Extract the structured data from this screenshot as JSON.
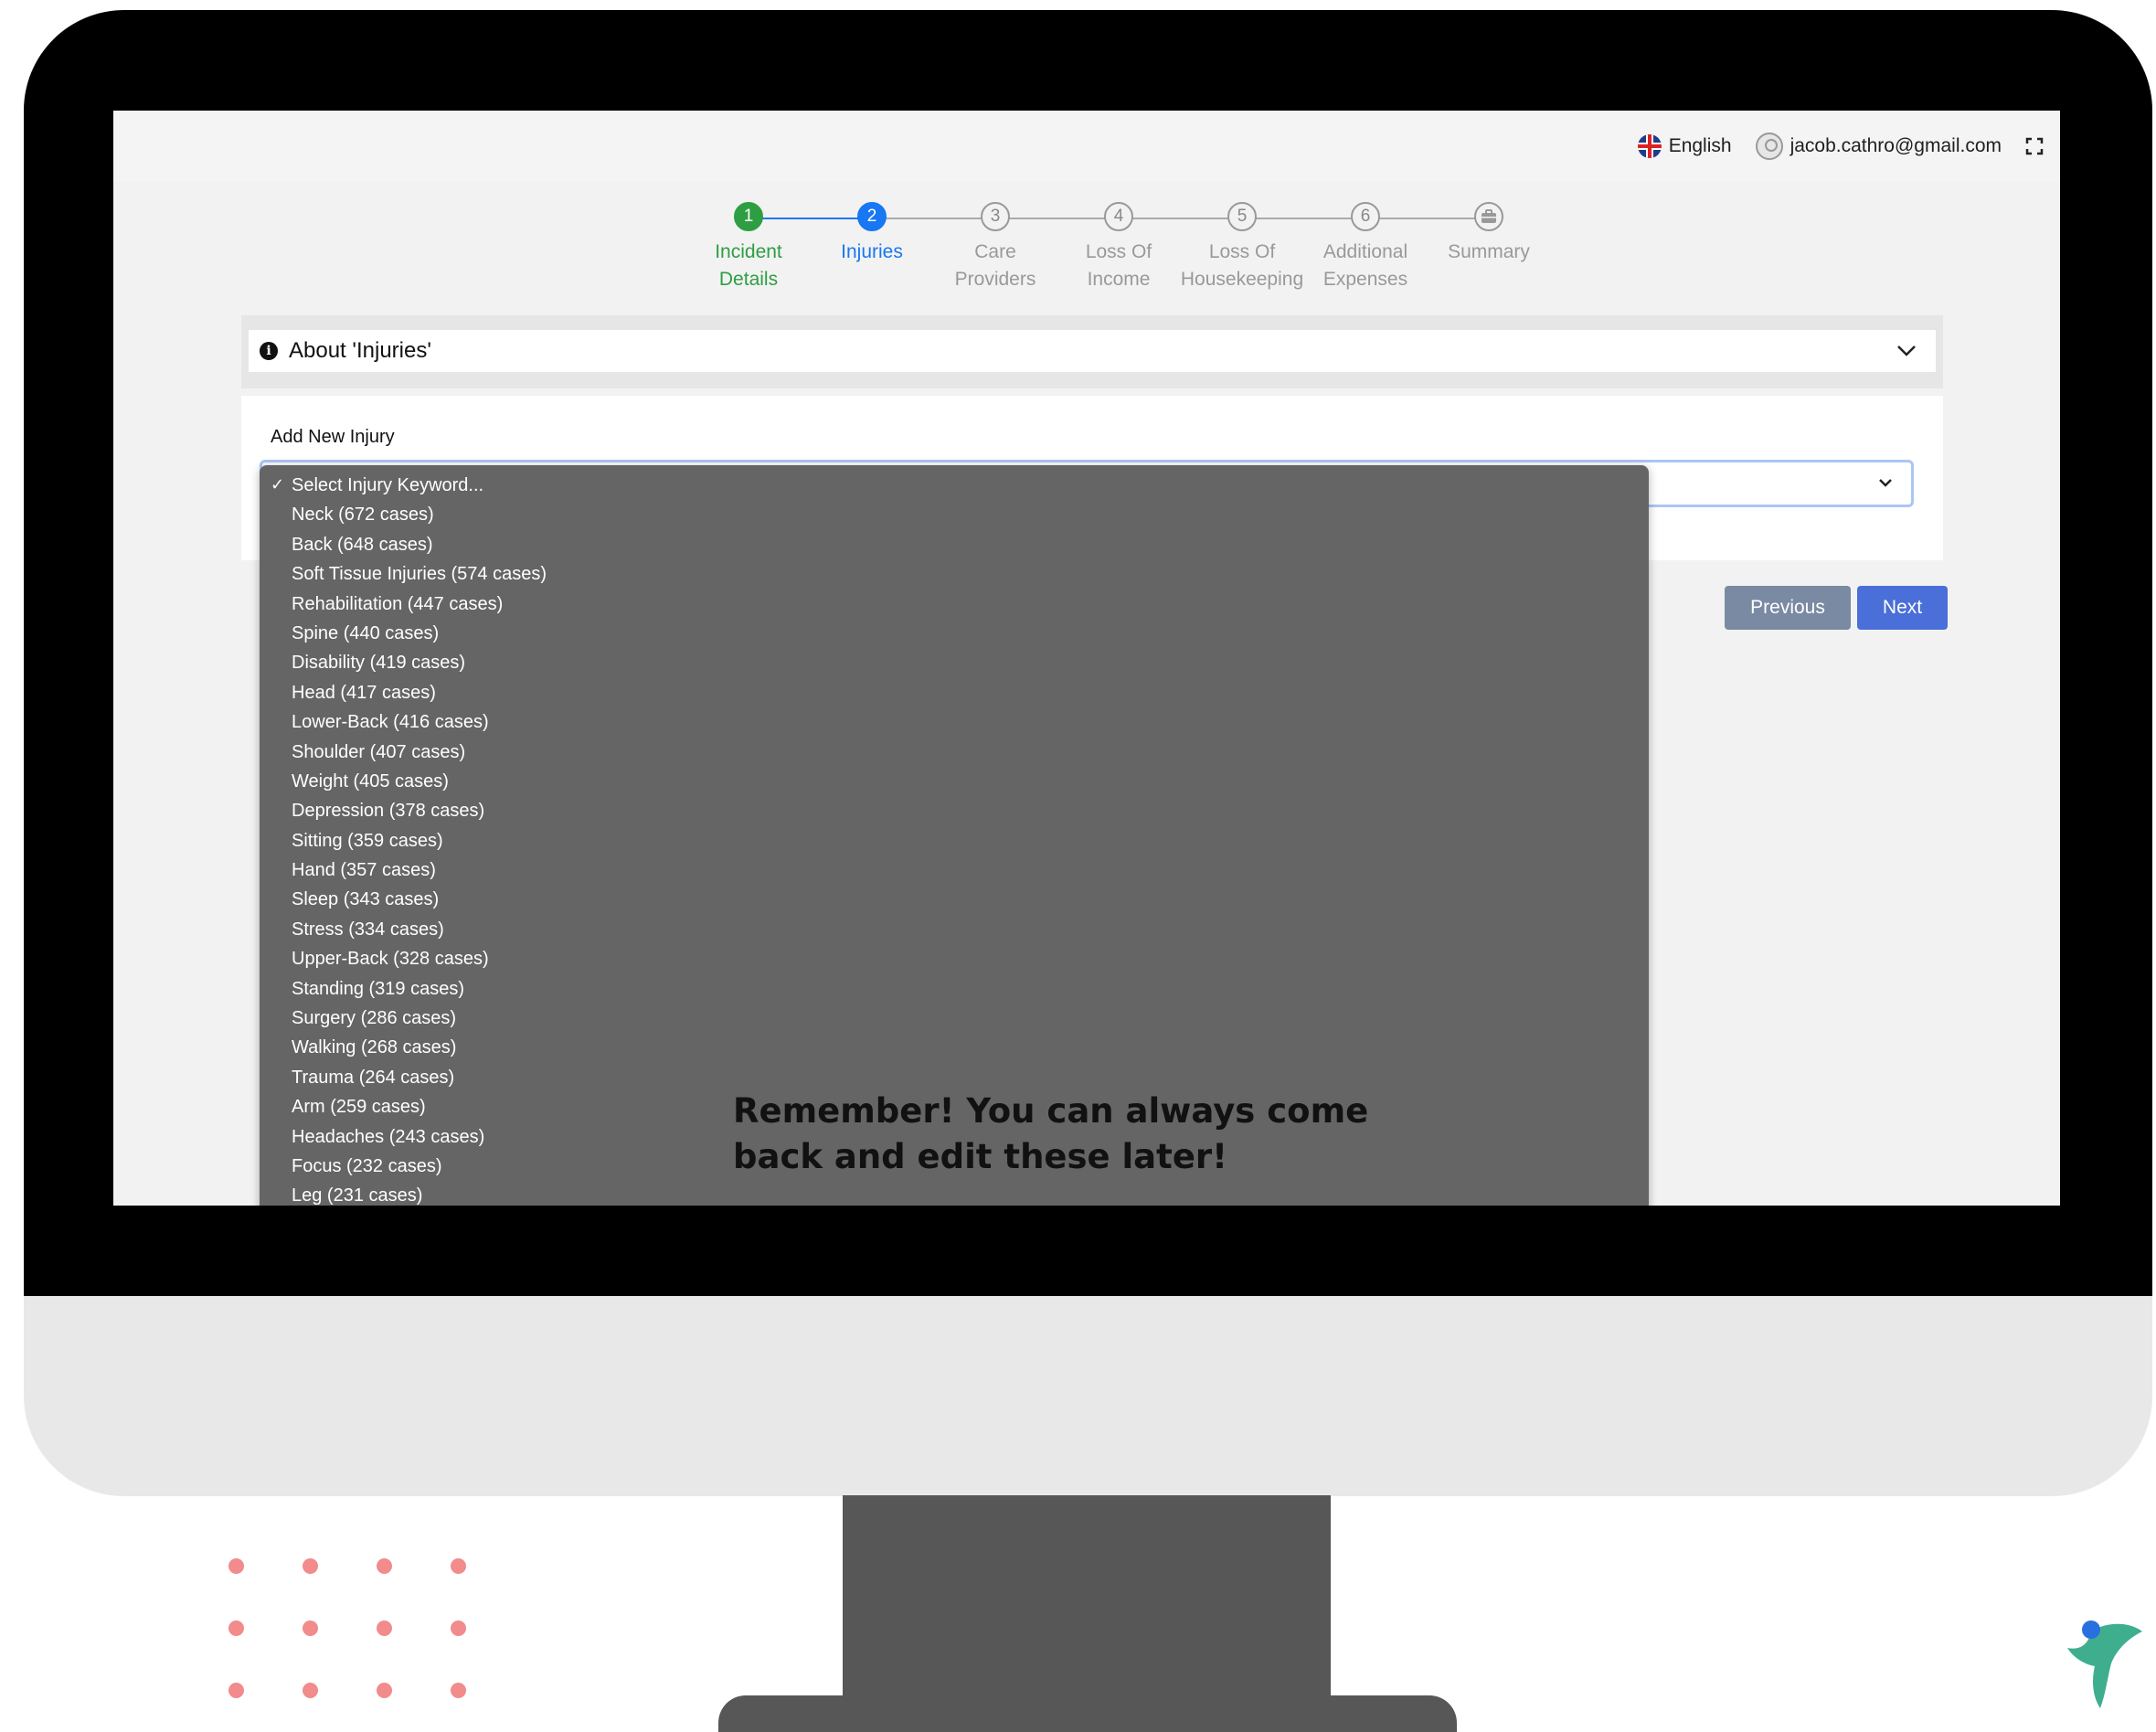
{
  "topbar": {
    "language": "English",
    "user_email": "jacob.cathro@gmail.com"
  },
  "stepper": {
    "steps": [
      {
        "number": "1",
        "line1": "Incident",
        "line2": "Details",
        "state": "done"
      },
      {
        "number": "2",
        "line1": "Injuries",
        "line2": "",
        "state": "active"
      },
      {
        "number": "3",
        "line1": "Care",
        "line2": "Providers",
        "state": "pending"
      },
      {
        "number": "4",
        "line1": "Loss Of",
        "line2": "Income",
        "state": "pending"
      },
      {
        "number": "5",
        "line1": "Loss Of",
        "line2": "Housekeeping",
        "state": "pending"
      },
      {
        "number": "6",
        "line1": "Additional",
        "line2": "Expenses",
        "state": "pending"
      },
      {
        "number": "",
        "line1": "Summary",
        "line2": "",
        "state": "pending",
        "icon": "briefcase-icon"
      }
    ]
  },
  "about": {
    "title": "About 'Injuries'"
  },
  "injury_form": {
    "label": "Add New Injury",
    "options": [
      "Select Injury Keyword...",
      "Neck (672 cases)",
      "Back (648 cases)",
      "Soft Tissue Injuries (574 cases)",
      "Rehabilitation (447 cases)",
      "Spine (440 cases)",
      "Disability (419 cases)",
      "Head (417 cases)",
      "Lower-Back (416 cases)",
      "Shoulder (407 cases)",
      "Weight (405 cases)",
      "Depression (378 cases)",
      "Sitting (359 cases)",
      "Hand (357 cases)",
      "Sleep (343 cases)",
      "Stress (334 cases)",
      "Upper-Back (328 cases)",
      "Standing (319 cases)",
      "Surgery (286 cases)",
      "Walking (268 cases)",
      "Trauma (264 cases)",
      "Arm (259 cases)",
      "Headaches (243 cases)",
      "Focus (232 cases)",
      "Leg (231 cases)"
    ],
    "selected_index": 0
  },
  "buttons": {
    "previous": "Previous",
    "next": "Next"
  },
  "overlay_text": {
    "line1": "Remember! You can always come",
    "line2": "back and edit these later!"
  },
  "colors": {
    "done": "#2e9e42",
    "active": "#1877f2",
    "next_button": "#4a6fd8",
    "previous_button": "#7a8aa3",
    "dropdown_bg": "#656565",
    "accent_dots": "#f28b8b"
  }
}
